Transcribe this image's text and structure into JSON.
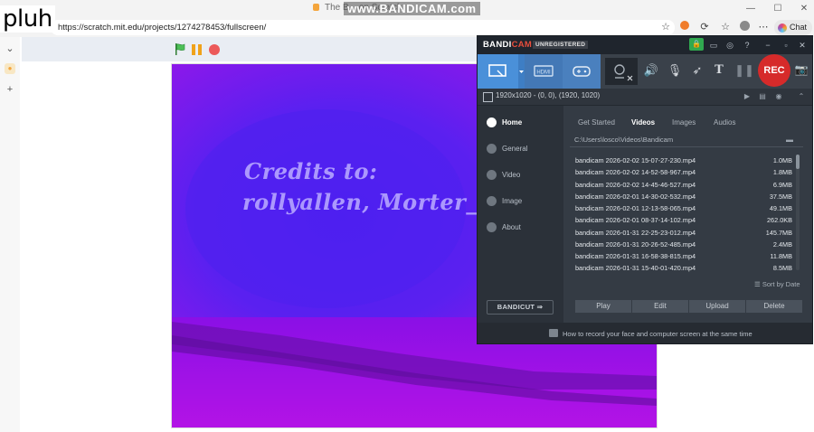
{
  "browser": {
    "tab_title": "The B... on Scratch",
    "url": "https://scratch.mit.edu/projects/1274278453/fullscreen/",
    "chat_label": "Chat",
    "min_icon": "minimize-icon",
    "max_icon": "maximize-icon",
    "close_icon": "close-icon"
  },
  "overlays": {
    "pluh_text": "pluh",
    "watermark": "www.BANDICAM.com"
  },
  "scratch": {
    "credits_line1": "Credits to:",
    "credits_line2": "rollyallen, Morter_sqidi"
  },
  "bandicam": {
    "brand_prefix": "BANDI",
    "brand_suffix": "CAM",
    "unregistered": "UNREGISTERED",
    "rec_label": "REC",
    "target_text": "1920x1020 - (0, 0), (1920, 1020)",
    "nav": [
      {
        "label": "Home",
        "icon": "home-icon"
      },
      {
        "label": "General",
        "icon": "gear-icon"
      },
      {
        "label": "Video",
        "icon": "video-icon"
      },
      {
        "label": "Image",
        "icon": "image-icon"
      },
      {
        "label": "About",
        "icon": "info-icon"
      }
    ],
    "tabs": [
      "Get Started",
      "Videos",
      "Images",
      "Audios"
    ],
    "active_tab": "Videos",
    "path": "C:\\Users\\losco\\Videos\\Bandicam",
    "files": [
      {
        "name": "bandicam 2026-02-02 15-07-27-230.mp4",
        "size": "1.0MB"
      },
      {
        "name": "bandicam 2026-02-02 14-52-58-967.mp4",
        "size": "1.8MB"
      },
      {
        "name": "bandicam 2026-02-02 14-45-46-527.mp4",
        "size": "6.9MB"
      },
      {
        "name": "bandicam 2026-02-01 14-30-02-532.mp4",
        "size": "37.5MB"
      },
      {
        "name": "bandicam 2026-02-01 12-13-58-065.mp4",
        "size": "49.1MB"
      },
      {
        "name": "bandicam 2026-02-01 08-37-14-102.mp4",
        "size": "262.0KB"
      },
      {
        "name": "bandicam 2026-01-31 22-25-23-012.mp4",
        "size": "145.7MB"
      },
      {
        "name": "bandicam 2026-01-31 20-26-52-485.mp4",
        "size": "2.4MB"
      },
      {
        "name": "bandicam 2026-01-31 16-58-38-815.mp4",
        "size": "11.8MB"
      },
      {
        "name": "bandicam 2026-01-31 15-40-01-420.mp4",
        "size": "8.5MB"
      }
    ],
    "sort_label": "Sort by Date",
    "actions": [
      "Play",
      "Edit",
      "Upload",
      "Delete"
    ],
    "bandicut_label": "BANDICUT",
    "footer_text": "How to record your face and computer screen at the same time",
    "accent": "#4a90d9",
    "rec_color": "#d62a2a"
  }
}
